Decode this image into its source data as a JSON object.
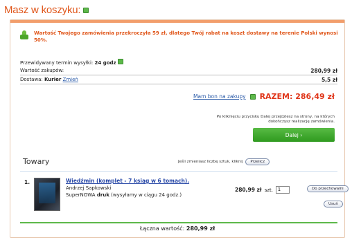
{
  "header": {
    "title": "Masz w koszyku:"
  },
  "promo": {
    "text": "Wartość Twojego zamówienia przekroczyła 59 zł, dlatego Twój rabat na koszt dostawy na terenie Polski wynosi 50%."
  },
  "summary": {
    "delivery_term_label": "Przewidywany termin wysyłki:",
    "delivery_term_value": "24 godz",
    "purchase_value_label": "Wartość zakupów:",
    "purchase_value": "280,99 zł",
    "shipping_label": "Dostawa:",
    "shipping_method": "Kurier",
    "shipping_change_link": "Zmień",
    "shipping_cost": "5,5 zł"
  },
  "total": {
    "voucher_link": "Mam bon na zakupy",
    "label": "RAZEM: 286,49 zł"
  },
  "hint": {
    "text": "Po kliknięciu przycisku Dalej przejdziesz na strony, na których dokończysz realizację zamówienia."
  },
  "next_button": {
    "label": "Dalej ›"
  },
  "items_section": {
    "title": "Towary",
    "recalc_hint": "Jeśli zmieniasz liczbę sztuk, kliknij",
    "recalc_button": "Przelicz"
  },
  "items": [
    {
      "number": "1.",
      "title": "Wiedźmin (komplet - 7 ksiąg w 6 tomach).",
      "author": "Andrzej Sapkowski",
      "edition_prefix": "SuperNOWA",
      "edition_bold": "druk",
      "edition_suffix": "(wysyłamy w ciągu 24 godz.)",
      "price": "280,99 zł",
      "qty_label": "szt.",
      "qty_value": "1",
      "store_button": "Do przechowalni",
      "delete_button": "Usuń"
    }
  ],
  "footer": {
    "total_label": "Łączna wartość:",
    "total_value": "280,99 zł"
  },
  "colors": {
    "accent": "#e0561a",
    "green": "#4ca52a",
    "link": "#2a5aa8",
    "total_red": "#e0361a"
  }
}
